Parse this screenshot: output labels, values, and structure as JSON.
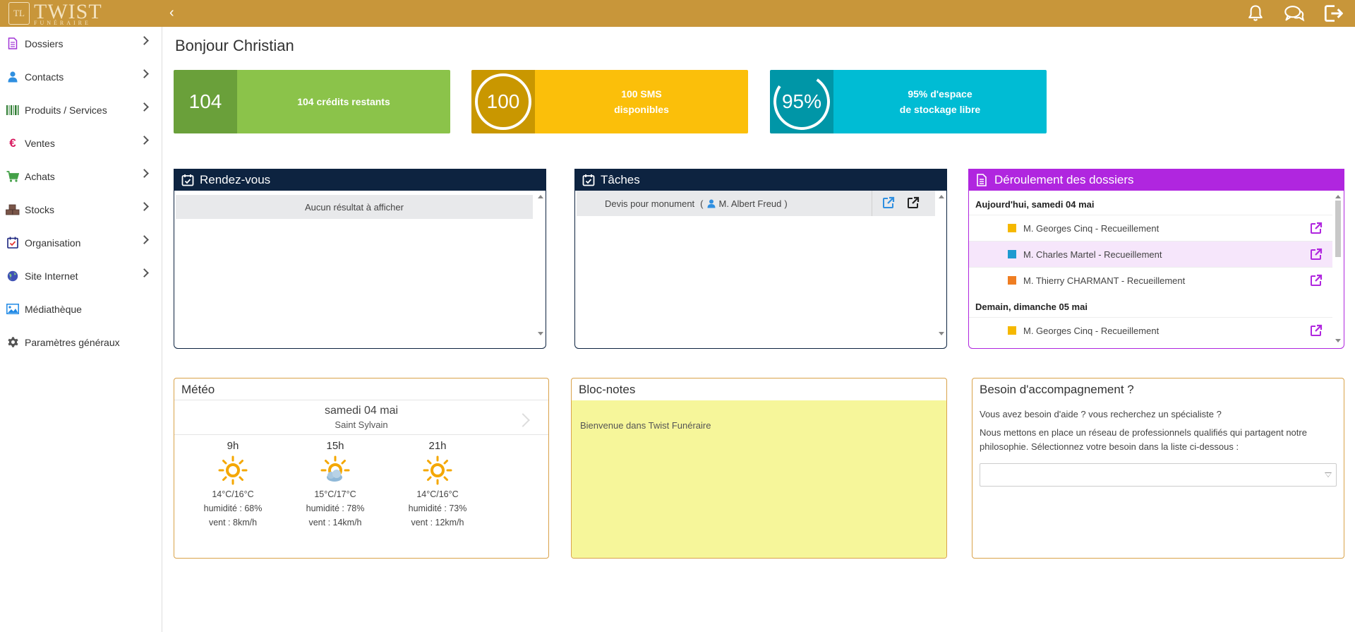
{
  "topbar": {
    "logo_mark": "TL",
    "logo_title": "TWIST",
    "logo_subtitle": "FUNÉRAIRE",
    "collapse_symbol": "‹",
    "icons": [
      "bell-icon",
      "chat-icon",
      "logout-icon"
    ],
    "color": "#c8963a"
  },
  "sidebar": {
    "items": [
      {
        "label": "Dossiers",
        "icon": "document-icon",
        "color": "#a033d6",
        "has_children": true
      },
      {
        "label": "Contacts",
        "icon": "user-icon",
        "color": "#2f8fe0",
        "has_children": true
      },
      {
        "label": "Produits / Services",
        "icon": "barcode-icon",
        "color": "#2e7d32",
        "has_children": true
      },
      {
        "label": "Ventes",
        "icon": "euro-icon",
        "color": "#d81b60",
        "has_children": true
      },
      {
        "label": "Achats",
        "icon": "cart-icon",
        "color": "#43a047",
        "has_children": true
      },
      {
        "label": "Stocks",
        "icon": "boxes-icon",
        "color": "#795548",
        "has_children": true
      },
      {
        "label": "Organisation",
        "icon": "calendar-check-icon",
        "color": "#1a237e",
        "has_children": true
      },
      {
        "label": "Site Internet",
        "icon": "globe-icon",
        "color": "#3f51b5",
        "has_children": true
      },
      {
        "label": "Médiathèque",
        "icon": "image-icon",
        "color": "#1e88e5",
        "has_children": false
      },
      {
        "label": "Paramètres généraux",
        "icon": "gear-icon",
        "color": "#555555",
        "has_children": false
      }
    ]
  },
  "greeting": "Bonjour Christian",
  "stats": [
    {
      "value": "104",
      "label_line1": "104 crédits restants",
      "label_line2": "",
      "dark": "#6aa03a",
      "light": "#8bc34a"
    },
    {
      "value": "100",
      "label_line1": "100 SMS",
      "label_line2": "disponibles",
      "dark": "#c99700",
      "light": "#fbbf0a"
    },
    {
      "value": "95%",
      "label_line1": "95% d'espace",
      "label_line2": "de stockage libre",
      "dark": "#0096a7",
      "light": "#00bcd4"
    }
  ],
  "rdv": {
    "title": "Rendez-vous",
    "empty": "Aucun résultat à afficher",
    "header_color": "#0d2340"
  },
  "taches": {
    "title": "Tâches",
    "header_color": "#0d2340",
    "rows": [
      {
        "label": "Devis pour monument",
        "paren_open": "(",
        "person": "M. Albert Freud",
        "paren_close": ")"
      }
    ]
  },
  "deroulement": {
    "title": "Déroulement des dossiers",
    "header_color": "#b026df",
    "days": [
      {
        "label": "Aujourd'hui, samedi 04 mai",
        "rows": [
          {
            "label": "M. Georges Cinq - Recueillement",
            "color": "#f5b800",
            "highlight": false
          },
          {
            "label": "M. Charles Martel - Recueillement",
            "color": "#1e9ad0",
            "highlight": true
          },
          {
            "label": "M. Thierry CHARMANT - Recueillement",
            "color": "#ef7d22",
            "highlight": false
          }
        ]
      },
      {
        "label": "Demain, dimanche 05 mai",
        "rows": [
          {
            "label": "M. Georges Cinq - Recueillement",
            "color": "#f5b800",
            "highlight": false
          }
        ]
      }
    ]
  },
  "meteo": {
    "title": "Météo",
    "date": "samedi 04 mai",
    "city": "Saint Sylvain",
    "forecasts": [
      {
        "hour": "9h",
        "icon": "sun-icon",
        "temp": "14°C/16°C",
        "humidity": "humidité : 68%",
        "wind": "vent : 8km/h"
      },
      {
        "hour": "15h",
        "icon": "sun-cloud-icon",
        "temp": "15°C/17°C",
        "humidity": "humidité : 78%",
        "wind": "vent : 14km/h"
      },
      {
        "hour": "21h",
        "icon": "sun-icon",
        "temp": "14°C/16°C",
        "humidity": "humidité : 73%",
        "wind": "vent : 12km/h"
      }
    ]
  },
  "blocnotes": {
    "title": "Bloc-notes",
    "content": "Bienvenue dans Twist Funéraire"
  },
  "accompagnement": {
    "title": "Besoin d'accompagnement ?",
    "line1": "Vous avez besoin d'aide ? vous recherchez un spécialiste ?",
    "line2": "Nous mettons en place un réseau de professionnels qualifiés qui partagent notre philosophie. Sélectionnez votre besoin dans la liste ci-dessous :",
    "select_value": ""
  }
}
